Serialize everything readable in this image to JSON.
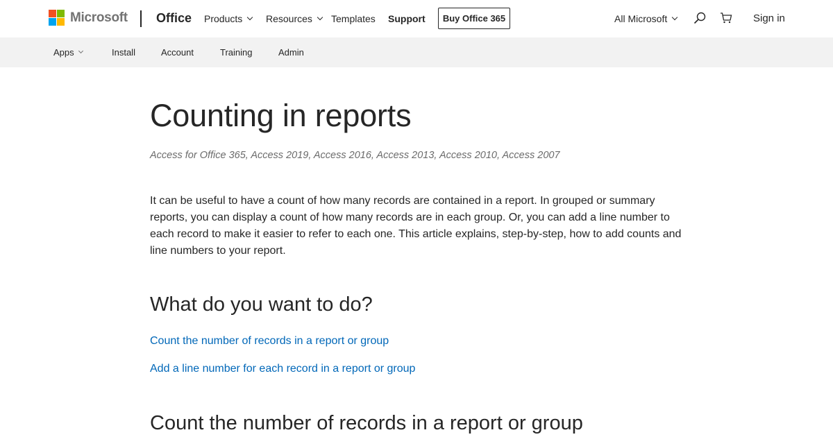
{
  "header": {
    "brand": "Microsoft",
    "brand_colors": [
      "#f25022",
      "#7fba00",
      "#00a4ef",
      "#ffb900"
    ],
    "office": "Office",
    "nav": [
      {
        "label": "Products",
        "has_dropdown": true
      },
      {
        "label": "Resources",
        "has_dropdown": true
      },
      {
        "label": "Templates",
        "has_dropdown": false
      },
      {
        "label": "Support",
        "has_dropdown": false
      }
    ],
    "buy_button": "Buy Office 365",
    "all_microsoft": "All Microsoft",
    "search_icon": "search-icon",
    "cart_icon": "cart-icon",
    "sign_in": "Sign in"
  },
  "subnav": {
    "items": [
      {
        "label": "Apps",
        "has_dropdown": true
      },
      {
        "label": "Install",
        "has_dropdown": false
      },
      {
        "label": "Account",
        "has_dropdown": false
      },
      {
        "label": "Training",
        "has_dropdown": false
      },
      {
        "label": "Admin",
        "has_dropdown": false
      }
    ]
  },
  "article": {
    "title": "Counting in reports",
    "applies_to": "Access for Office 365, Access 2019, Access 2016, Access 2013, Access 2010, Access 2007",
    "intro": "It can be useful to have a count of how many records are contained in a report. In grouped or summary reports, you can display a count of how many records are in each group. Or, you can add a line number to each record to make it easier to refer to each one. This article explains, step-by-step, how to add counts and line numbers to your report.",
    "toc_heading": "What do you want to do?",
    "toc_links": [
      "Count the number of records in a report or group",
      "Add a line number for each record in a report or group"
    ],
    "section_heading": "Count the number of records in a report or group"
  },
  "colors": {
    "link": "#0067b8",
    "text": "#262626",
    "subnav_bg": "#f2f2f2"
  }
}
